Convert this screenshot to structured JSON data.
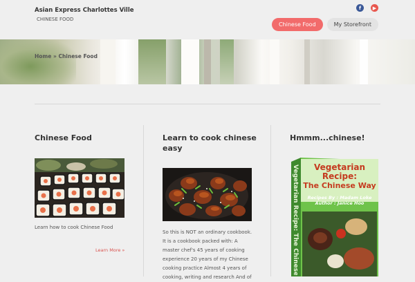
{
  "header": {
    "site_title": "Asian Express Charlottes Ville",
    "tagline": "CHINESE FOOD",
    "social": [
      {
        "name": "facebook",
        "glyph": "f"
      },
      {
        "name": "youtube",
        "glyph": "▶"
      }
    ],
    "nav": [
      {
        "label": "Chinese Food",
        "active": true
      },
      {
        "label": "My Storefront",
        "active": false
      }
    ]
  },
  "breadcrumb": {
    "home": "Home",
    "sep": "»",
    "current": "Chinese Food"
  },
  "columns": [
    {
      "title": "Chinese Food",
      "excerpt": "Learn how to cook Chinese Food",
      "more_label": "Learn More »",
      "image": "sushi-platter"
    },
    {
      "title_line1": "Learn to cook chinese",
      "title_line2": "easy",
      "excerpt_lines": [
        "So this is NOT an ordinary cookbook.",
        "It is a cookbook packed with: A",
        "master chef's 45 years of cooking",
        "experience 20 years of my Chinese",
        "cooking practice Almost 4 years of",
        "cooking, writing and research And of"
      ],
      "image": "chinese-dish"
    },
    {
      "title": "Hmmm...chinese!",
      "image": "cookbook-cover",
      "book": {
        "title1": "Vegetarian",
        "title2": "Recipe:",
        "title3": "The Chinese Way",
        "credit1": "Recipes By : Madam Loke",
        "credit2": "Author : Janice Hoo",
        "spine": "Vegetarian Recipe: The Chinese Way"
      }
    }
  ],
  "colors": {
    "accent": "#f26b6b",
    "link": "#d9534f",
    "background": "#efefef"
  }
}
